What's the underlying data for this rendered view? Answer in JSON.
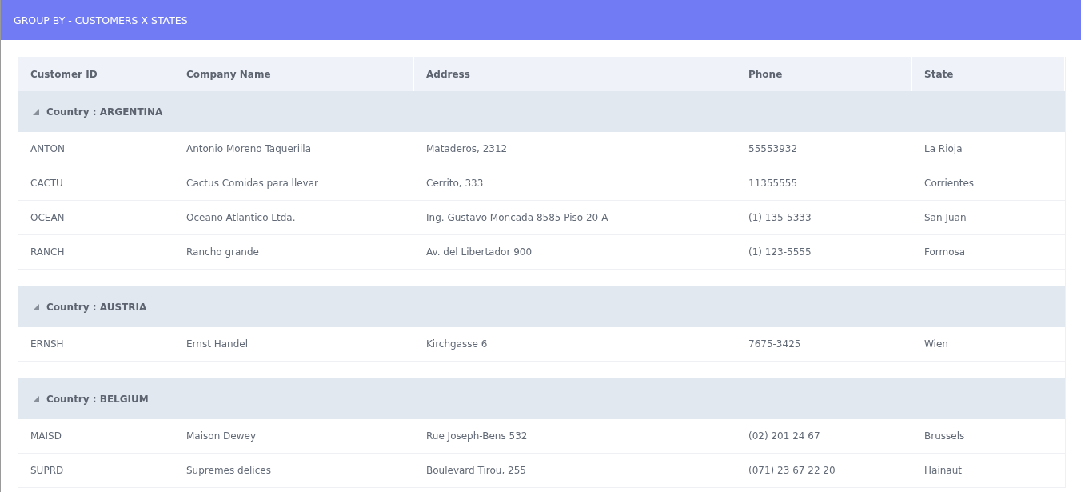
{
  "header": {
    "title": "GROUP BY - CUSTOMERS X STATES"
  },
  "table": {
    "columns": [
      "Customer ID",
      "Company Name",
      "Address",
      "Phone",
      "State"
    ],
    "groups": [
      {
        "label": "Country : ARGENTINA",
        "expanded": true,
        "rows": [
          [
            "ANTON",
            "Antonio Moreno Taqueriila",
            "Mataderos, 2312",
            "55553932",
            "La Rioja"
          ],
          [
            "CACTU",
            "Cactus Comidas para llevar",
            "Cerrito, 333",
            "11355555",
            "Corrientes"
          ],
          [
            "OCEAN",
            "Oceano Atlantico Ltda.",
            "Ing. Gustavo Moncada 8585 Piso 20-A",
            "(1) 135-5333",
            "San Juan"
          ],
          [
            "RANCH",
            "Rancho grande",
            "Av. del Libertador 900",
            "(1) 123-5555",
            "Formosa"
          ]
        ]
      },
      {
        "label": "Country : AUSTRIA",
        "expanded": true,
        "rows": [
          [
            "ERNSH",
            "Ernst Handel",
            "Kirchgasse 6",
            "7675-3425",
            "Wien"
          ]
        ]
      },
      {
        "label": "Country : BELGIUM",
        "expanded": true,
        "rows": [
          [
            "MAISD",
            "Maison Dewey",
            "Rue Joseph-Bens 532",
            "(02) 201 24 67",
            "Brussels"
          ],
          [
            "SUPRD",
            "Supremes delices",
            "Boulevard Tirou, 255",
            "(071) 23 67 22 20",
            "Hainaut"
          ]
        ]
      }
    ]
  }
}
